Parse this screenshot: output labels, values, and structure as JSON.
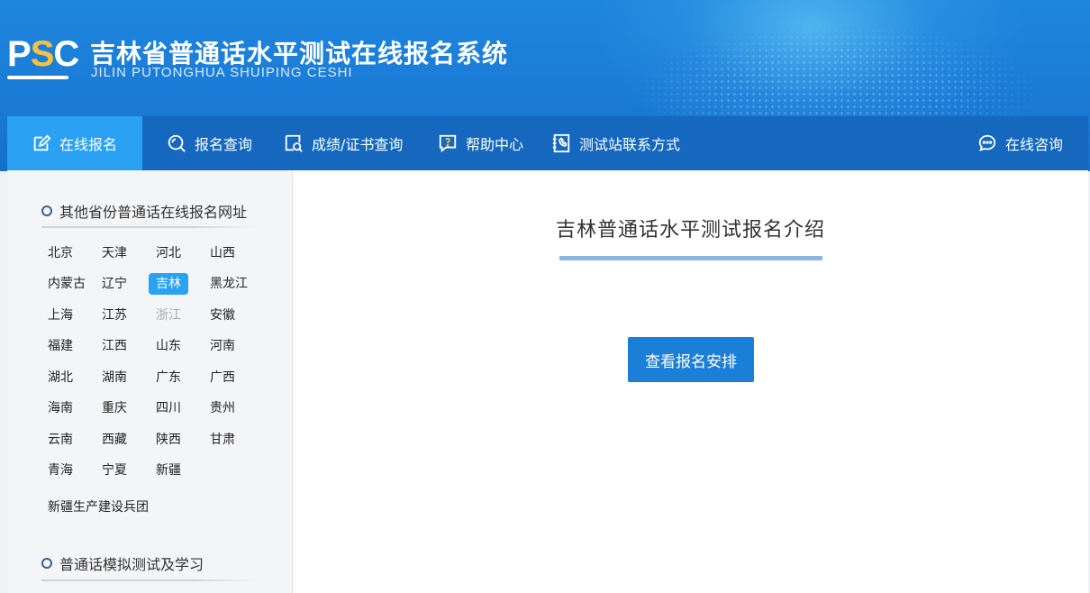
{
  "header": {
    "logo_text": "PSC",
    "title": "吉林省普通话水平测试在线报名系统",
    "subtitle": "JILIN PUTONGHUA SHUIPING CESHI"
  },
  "nav": {
    "items": [
      {
        "label": "在线报名",
        "icon": "edit-icon",
        "active": true
      },
      {
        "label": "报名查询",
        "icon": "search-icon"
      },
      {
        "label": "成绩/证书查询",
        "icon": "certificate-search-icon"
      },
      {
        "label": "帮助中心",
        "icon": "help-icon"
      },
      {
        "label": "测试站联系方式",
        "icon": "phone-book-icon"
      }
    ],
    "consult": {
      "label": "在线咨询",
      "icon": "chat-icon"
    }
  },
  "sidebar": {
    "provinces_heading": "其他省份普通话在线报名网址",
    "provinces": [
      "北京",
      "天津",
      "河北",
      "山西",
      "内蒙古",
      "辽宁",
      "吉林",
      "黑龙江",
      "上海",
      "江苏",
      "浙江",
      "安徽",
      "福建",
      "江西",
      "山东",
      "河南",
      "湖北",
      "湖南",
      "广东",
      "广西",
      "海南",
      "重庆",
      "四川",
      "贵州",
      "云南",
      "西藏",
      "陕西",
      "甘肃",
      "青海",
      "宁夏",
      "新疆"
    ],
    "selected_province": "吉林",
    "disabled_province": "浙江",
    "bingtuan": "新疆生产建设兵团",
    "mock_heading": "普通话模拟测试及学习"
  },
  "main": {
    "title": "吉林普通话水平测试报名介绍",
    "button_label": "查看报名安排"
  },
  "colors": {
    "header_blue": "#1a7bd6",
    "nav_blue": "#1568bd",
    "active_blue": "#2aa1f2",
    "button_blue": "#1c7fd7",
    "logo_accent": "#f6c243"
  }
}
